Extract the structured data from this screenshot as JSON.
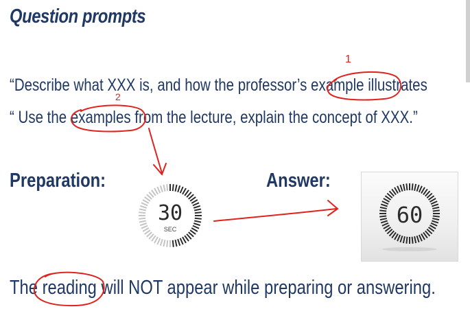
{
  "slide": {
    "title": "Question prompts",
    "prompt_1": "“Describe what XXX is, and how the professor’s example illustrates",
    "prompt_2": "“ Use the examples from the lecture, explain the concept of XXX.”",
    "preparation_label": "Preparation:",
    "answer_label": "Answer:",
    "preparation_timer": {
      "value": "30",
      "unit": "SEC"
    },
    "answer_timer": {
      "value": "60"
    },
    "footer": "The reading will NOT appear while preparing or answering."
  },
  "annotations": {
    "mark_1": "1",
    "mark_2": "2",
    "ink_color": "#e0221d"
  },
  "colors": {
    "text": "#1f3864"
  }
}
